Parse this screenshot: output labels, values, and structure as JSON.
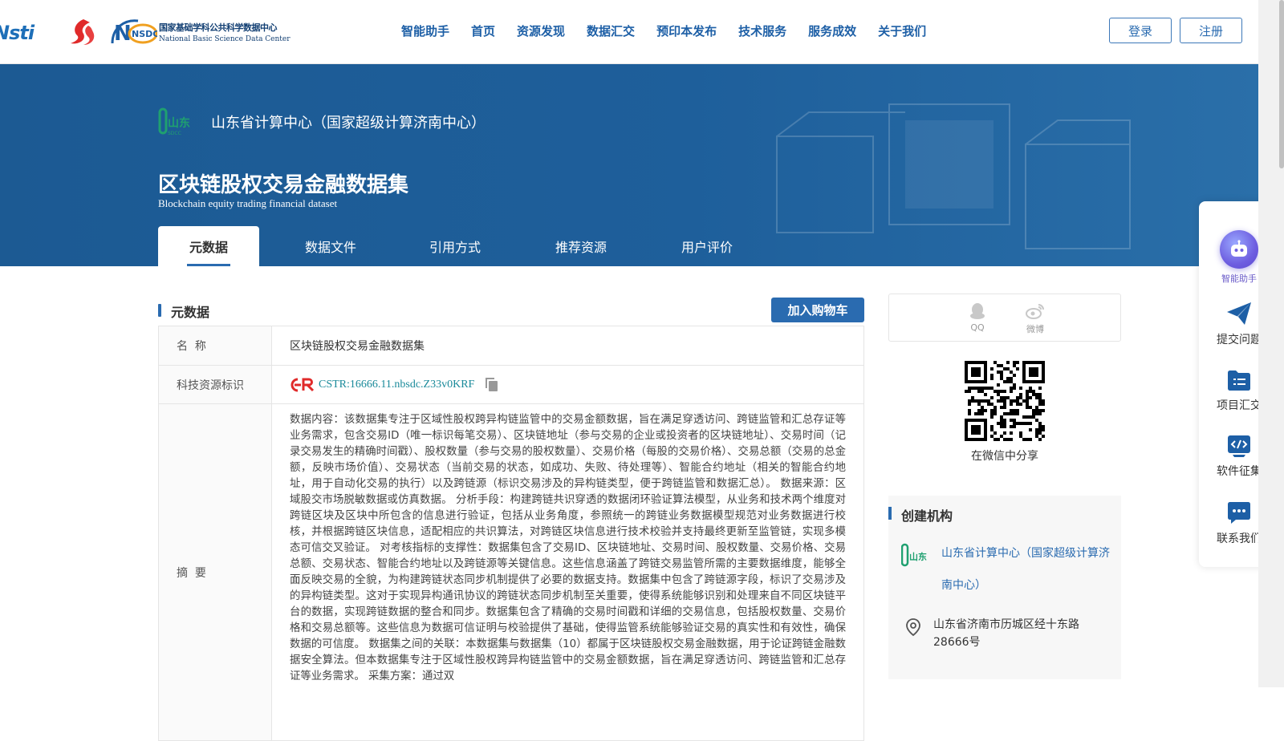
{
  "header": {
    "nav": [
      "智能助手",
      "首页",
      "资源发现",
      "数据汇交",
      "预印本发布",
      "技术服务",
      "服务成效",
      "关于我们"
    ],
    "login_label": "登录",
    "register_label": "注册",
    "logo_nsti_text": "Nsti",
    "logo_nsdc_cn": "国家基础学科公共科学数据中心",
    "logo_nsdc_en": "National Basic Science Data Center",
    "logo_nsdc_mark": "NSDC"
  },
  "banner": {
    "org_name": "山东省计算中心（国家超级计算济南中心）",
    "title": "区块链股权交易金融数据集",
    "subtitle": "Blockchain equity trading financial dataset",
    "tabs": [
      "元数据",
      "数据文件",
      "引用方式",
      "推荐资源",
      "用户评价"
    ]
  },
  "metadata": {
    "section_title": "元数据",
    "cart_label": "加入购物车",
    "rows": [
      {
        "label": "名  称",
        "value": "区块链股权交易金融数据集"
      },
      {
        "label": "科技资源标识",
        "value": "CSTR:16666.11.nbsdc.Z33v0KRF"
      },
      {
        "label": "摘  要",
        "value": "数据内容：该数据集专注于区域性股权跨异构链监管中的交易金额数据，旨在满足穿透访问、跨链监管和汇总存证等业务需求，包含交易ID（唯一标识每笔交易）、区块链地址（参与交易的企业或投资者的区块链地址）、交易时间（记录交易发生的精确时间戳）、股权数量（参与交易的股权数量）、交易价格（每股的交易价格）、交易总额（交易的总金额，反映市场价值）、交易状态（当前交易的状态，如成功、失败、待处理等）、智能合约地址（相关的智能合约地址，用于自动化交易的执行）以及跨链源（标识交易涉及的异构链类型，便于跨链监管和数据汇总）。 数据来源：区域股交市场脱敏数据或仿真数据。 分析手段：构建跨链共识穿透的数据闭环验证算法模型，从业务和技术两个维度对跨链区块及区块中所包含的信息进行验证，包括从业务角度，参照统一的跨链业务数据模型规范对业务数据进行校核，并根据跨链区块信息，适配相应的共识算法，对跨链区块信息进行技术校验并支持最终更新至监管链，实现多模态可信交叉验证。 对考核指标的支撑性：数据集包含了交易ID、区块链地址、交易时间、股权数量、交易价格、交易总额、交易状态、智能合约地址以及跨链源等关键信息。这些信息涵盖了跨链交易监管所需的主要数据维度，能够全面反映交易的全貌，为构建跨链状态同步机制提供了必要的数据支持。数据集中包含了跨链源字段，标识了交易涉及的异构链类型。这对于实现异构通讯协议的跨链状态同步机制至关重要，使得系统能够识别和处理来自不同区块链平台的数据，实现跨链数据的整合和同步。数据集包含了精确的交易时间戳和详细的交易信息，包括股权数量、交易价格和交易总额等。这些信息为数据可信证明与校验提供了基础，使得监管系统能够验证交易的真实性和有效性，确保数据的可信度。 数据集之间的关联：本数据集与数据集（10）都属于区块链股权交易金融数据，用于论证跨链金融数据安全算法。但本数据集专注于区域性股权跨异构链监管中的交易金额数据，旨在满足穿透访问、跨链监管和汇总存证等业务需求。 采集方案：通过双"
      }
    ]
  },
  "share": {
    "qq_label": "QQ",
    "weibo_label": "微博",
    "wechat_label": "在微信中分享"
  },
  "creator": {
    "section_title": "创建机构",
    "org_name": "山东省计算中心（国家超级计算济南中心）",
    "address": "山东省济南市历城区经十东路28666号"
  },
  "float_bar": {
    "items": [
      "智能助手",
      "提交问题",
      "项目汇交",
      "软件征集",
      "联系我们"
    ]
  },
  "colors": {
    "brand_blue": "#2a6bb0",
    "banner_blue": "#1c5a93",
    "nav_blue": "#1d5fa6",
    "cstr_teal": "#1a8a9a",
    "ai_purple": "#6e5ee0"
  }
}
